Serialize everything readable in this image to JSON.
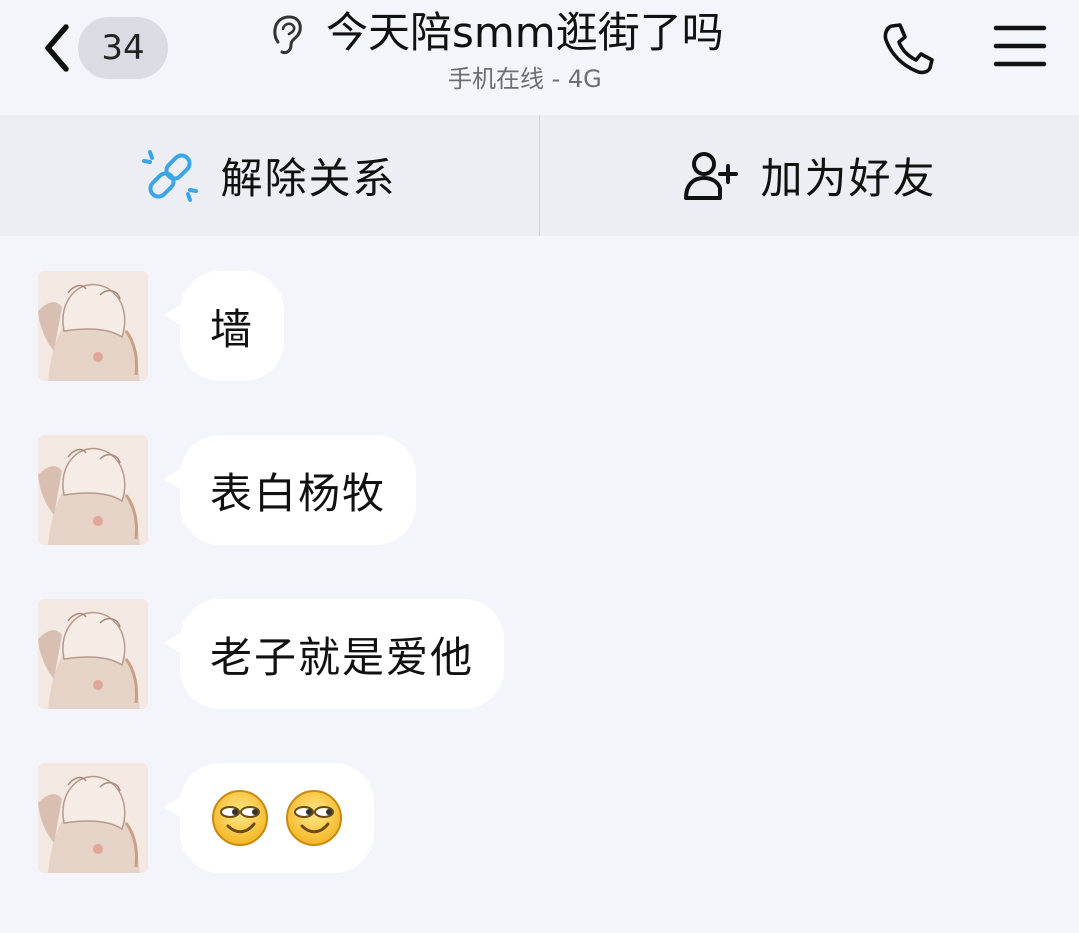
{
  "header": {
    "back_label": "back",
    "unread_count": "34",
    "title": "今天陪smm逛街了吗",
    "status": "手机在线 - 4G"
  },
  "action_bar": {
    "unlink_label": "解除关系",
    "add_friend_label": "加为好友"
  },
  "messages": [
    {
      "text": "墙"
    },
    {
      "text": "表白杨牧"
    },
    {
      "text": "老子就是爱他"
    },
    {
      "emojis": [
        "smirk-face",
        "smirk-face"
      ]
    }
  ],
  "colors": {
    "background": "#f3f5fa",
    "action_bar": "#eceef3",
    "bubble": "#ffffff",
    "unlink_icon": "#3aa6e8",
    "badge": "#d9dce3"
  }
}
